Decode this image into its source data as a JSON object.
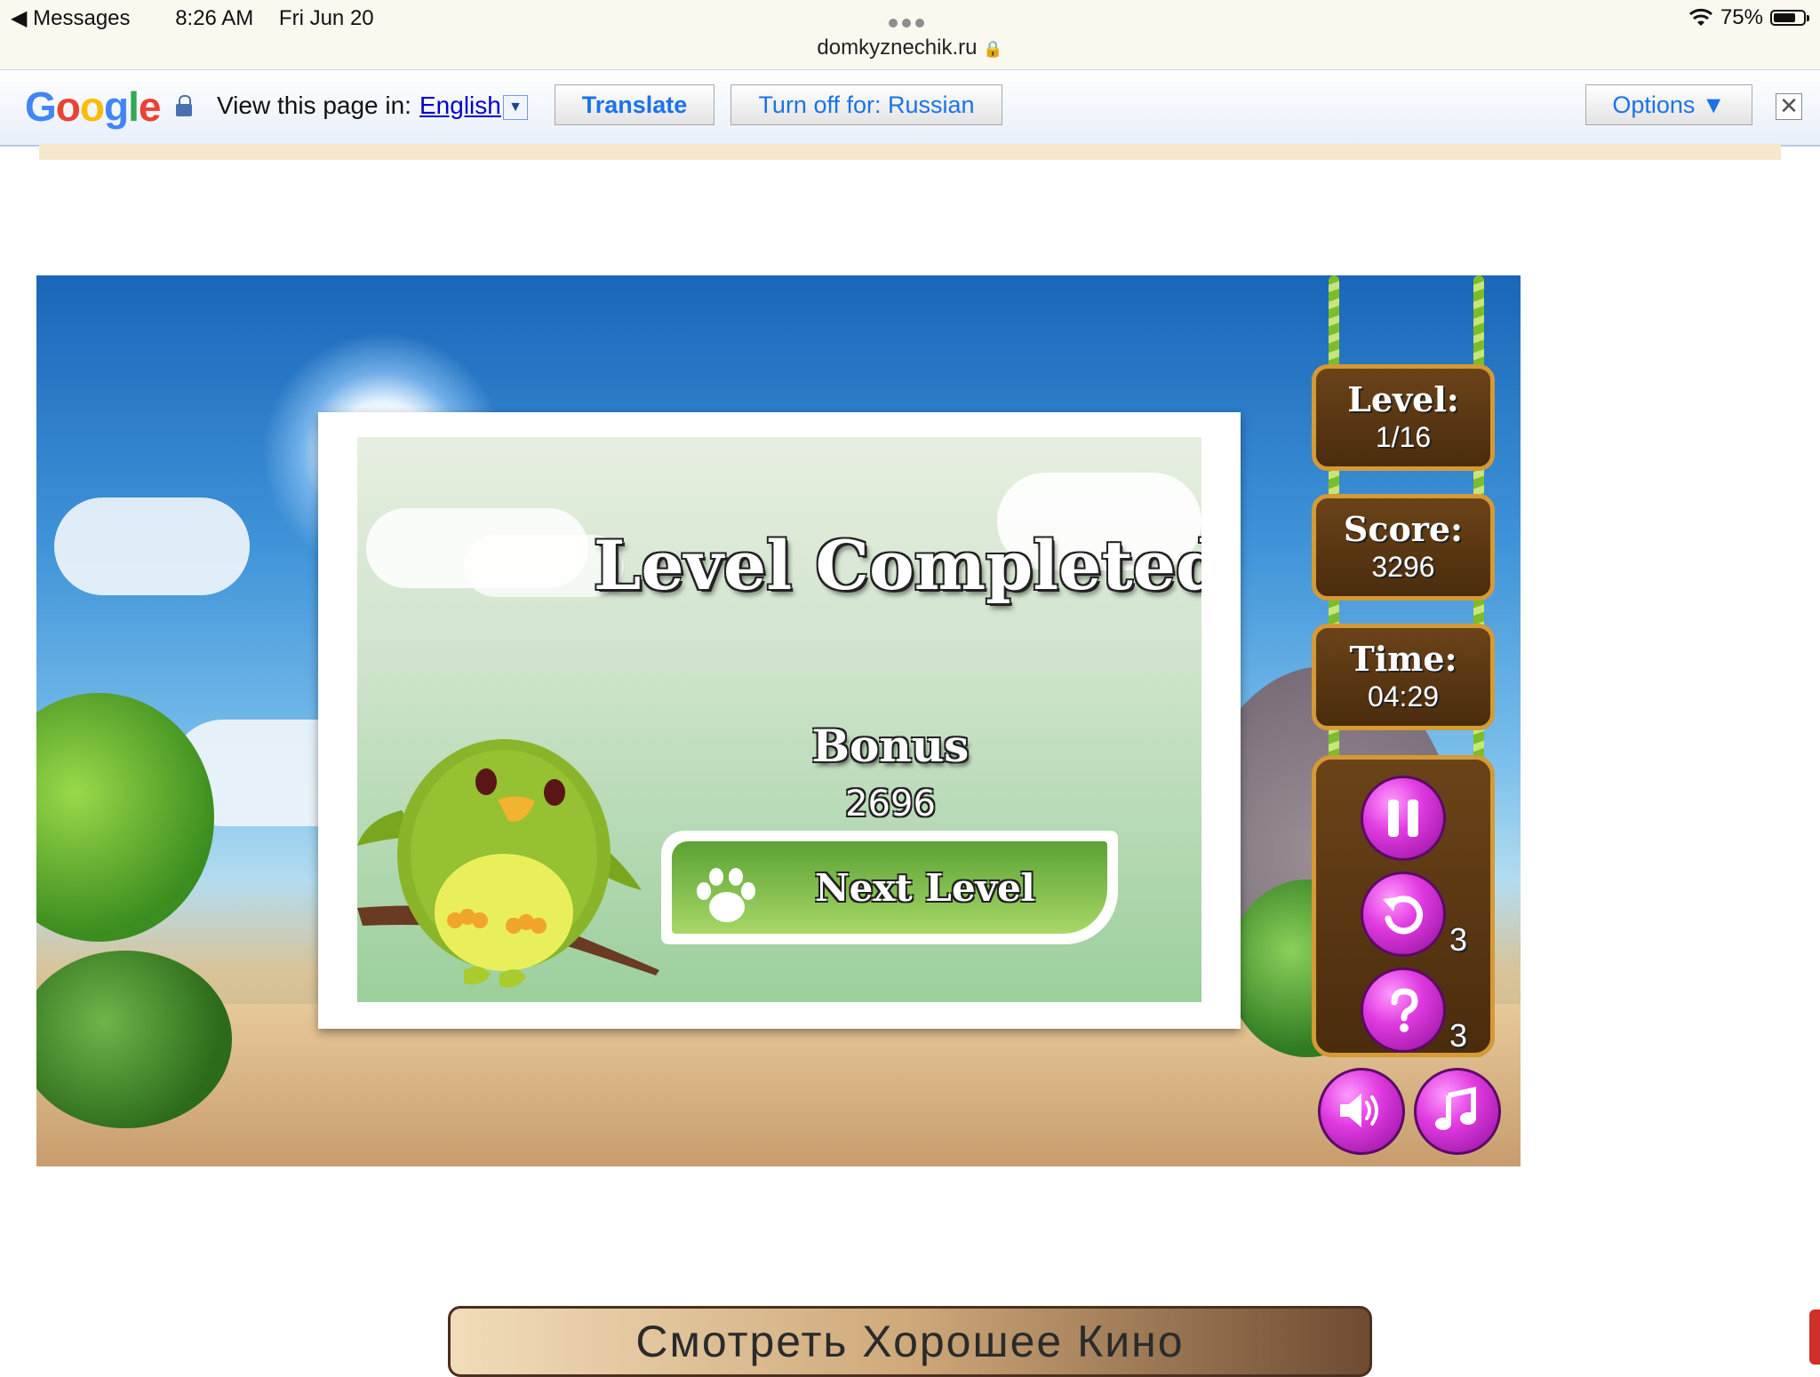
{
  "status_bar": {
    "back_app": "Messages",
    "time": "8:26 AM",
    "date": "Fri Jun 20",
    "url": "domkyznechik.ru",
    "battery": "75%"
  },
  "translate_bar": {
    "prompt": "View this page in:",
    "language": "English",
    "translate_label": "Translate",
    "turn_off_label": "Turn off for: Russian",
    "options_label": "Options ▼"
  },
  "game": {
    "dialog": {
      "title": "Level Completed",
      "bonus_label": "Bonus",
      "bonus_value": "2696",
      "next_label": "Next Level"
    },
    "hud": {
      "level_label": "Level:",
      "level_value": "1/16",
      "score_label": "Score:",
      "score_value": "3296",
      "time_label": "Time:",
      "time_value": "04:29",
      "undo_count": "3",
      "hint_count": "3"
    }
  },
  "banner": {
    "text": "Смотреть Хорошее Кино"
  },
  "colors": {
    "accent_purple": "#d12fd6",
    "wood": "#5a3611",
    "vine_green": "#7bbd2a",
    "panel_green": "#9ccf9c"
  }
}
